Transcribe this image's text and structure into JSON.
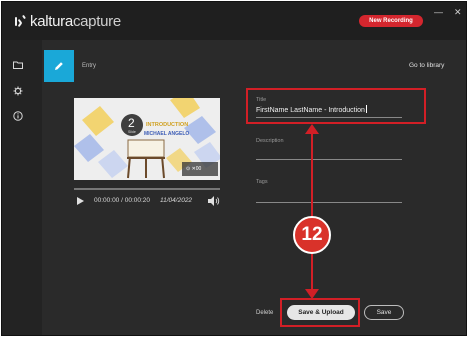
{
  "app": {
    "brand_prefix": "kaltura",
    "brand_suffix": "capture",
    "new_recording": "New Recording"
  },
  "window_controls": {
    "minimize": "—",
    "close": "✕"
  },
  "sidebar": {
    "icons": [
      "folder-icon",
      "gear-icon",
      "info-icon"
    ]
  },
  "header": {
    "entry_label": "Entry",
    "go_to_library": "Go to library"
  },
  "thumbnail": {
    "slide_number": "2",
    "slide_sub": "Slide",
    "slide_title": "INTRODUCTION",
    "slide_author": "MICHAEL ANGELO",
    "overlay_controls": "⊙ ✕00"
  },
  "player": {
    "time": "00:00:00 / 00:00:20",
    "date": "11/04/2022"
  },
  "form": {
    "title_label": "Title",
    "title_value": "FirstName LastName - Introduction",
    "description_label": "Description",
    "tags_label": "Tags"
  },
  "annotation": {
    "step_number": "12",
    "highlight_color": "#d21f26"
  },
  "actions": {
    "delete": "Delete",
    "save_upload": "Save & Upload",
    "save": "Save"
  },
  "colors": {
    "accent": "#1aa8d8",
    "record": "#d4262e"
  }
}
